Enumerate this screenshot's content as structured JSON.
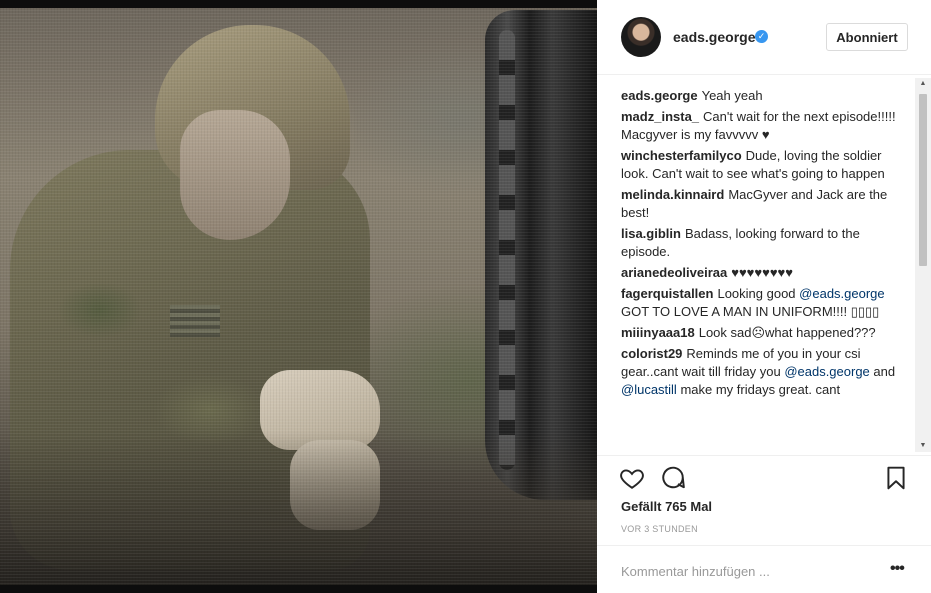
{
  "post": {
    "username": "eads.george",
    "verified_icon": "verified-check-icon",
    "follow_label": "Abonniert",
    "photo_icon": "soldier-photo"
  },
  "comments": [
    {
      "author": "eads.george",
      "text": "Yeah yeah"
    },
    {
      "author": "madz_insta_",
      "text": "Can't wait for the next episode!!!!! Macgyver is my favvvvv ♥"
    },
    {
      "author": "winchesterfamilyco",
      "text": "Dude, loving the soldier look. Can't wait to see what's going to happen"
    },
    {
      "author": "melinda.kinnaird",
      "text": "MacGyver and Jack are the best!"
    },
    {
      "author": "lisa.giblin",
      "text": "Badass, looking forward to the episode."
    },
    {
      "author": "arianedeoliveiraa",
      "text": "♥♥♥♥♥♥♥♥"
    },
    {
      "author": "fagerquistallen",
      "text": "Looking good ",
      "mention": "@eads.george",
      "text_after": " GOT TO LOVE A MAN IN UNIFORM!!!! ▯▯▯▯"
    },
    {
      "author": "miiinyaaa18",
      "text": "Look sad☹what happened???"
    },
    {
      "author": "colorist29",
      "text": "Reminds me of you in your csi gear..cant wait till friday you ",
      "mention": "@eads.george",
      "text_after": " and ",
      "mention2": "@lucastill",
      "text_after2": " make my fridays great. cant"
    }
  ],
  "actions": {
    "like_icon": "heart-icon",
    "comment_icon": "speech-bubble-icon",
    "save_icon": "bookmark-icon",
    "likes_text": "Gefällt 765 Mal",
    "timestamp": "VOR 3 STUNDEN"
  },
  "comment_box": {
    "placeholder": "Kommentar hinzufügen ...",
    "more_label": "•••"
  },
  "scrollbar": {
    "up": "▲",
    "down": "▼"
  }
}
